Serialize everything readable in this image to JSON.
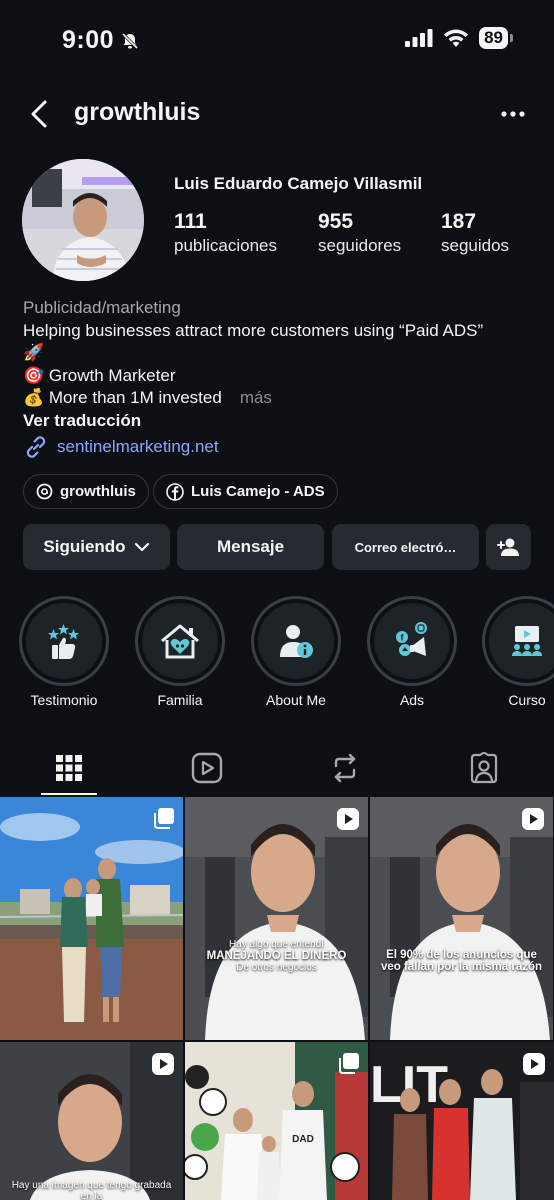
{
  "status_bar": {
    "time": "9:00",
    "battery": "89"
  },
  "header": {
    "username": "growthluis"
  },
  "profile": {
    "full_name": "Luis Eduardo Camejo Villasmil",
    "stats": [
      {
        "value": "111",
        "label": "publicaciones"
      },
      {
        "value": "955",
        "label": "seguidores"
      },
      {
        "value": "187",
        "label": "seguidos"
      }
    ]
  },
  "bio": {
    "category": "Publicidad/marketing",
    "line1": "Helping businesses attract more customers using “Paid ADS”",
    "line2_emoji": "🚀",
    "line3": "🎯 Growth Marketer",
    "line4": "💰 More than 1M invested",
    "more": "más",
    "translate": "Ver traducción",
    "link": "sentinelmarketing.net"
  },
  "chips": [
    {
      "label": "growthluis",
      "icon": "threads-icon"
    },
    {
      "label": "Luis Camejo - ADS",
      "icon": "facebook-icon"
    }
  ],
  "actions": {
    "following": "Siguiendo",
    "message": "Mensaje",
    "email": "Correo electró…"
  },
  "highlights": [
    {
      "label": "Testimonio",
      "icon": "thumbs-up-stars-icon"
    },
    {
      "label": "Familia",
      "icon": "house-heart-icon"
    },
    {
      "label": "About Me",
      "icon": "person-info-icon"
    },
    {
      "label": "Ads",
      "icon": "megaphone-social-icon"
    },
    {
      "label": "Curso",
      "icon": "classroom-icon"
    }
  ],
  "tabs": [
    "grid-icon",
    "reels-icon",
    "reposts-icon",
    "tagged-icon"
  ],
  "posts": [
    {
      "type": "carousel",
      "caption": ""
    },
    {
      "type": "reel",
      "caption_top": "Hay algo que entendí",
      "caption_big": "MANEJANDO EL DINERO",
      "caption_bottom": "De otros negocios"
    },
    {
      "type": "reel",
      "caption_top": "",
      "caption_big": "El 90% de los anuncios que veo fallan por la misma razón",
      "caption_bottom": ""
    },
    {
      "type": "reel",
      "caption_top": "Hay una imagen que tengo grabada en la",
      "caption_big": "",
      "caption_bottom": ""
    },
    {
      "type": "carousel",
      "caption": ""
    },
    {
      "type": "reel",
      "caption": ""
    }
  ],
  "colors": {
    "background": "#0c1014",
    "button": "#262b31",
    "link": "#8fa6ff",
    "highlight_icon": "#5ec8d8"
  }
}
